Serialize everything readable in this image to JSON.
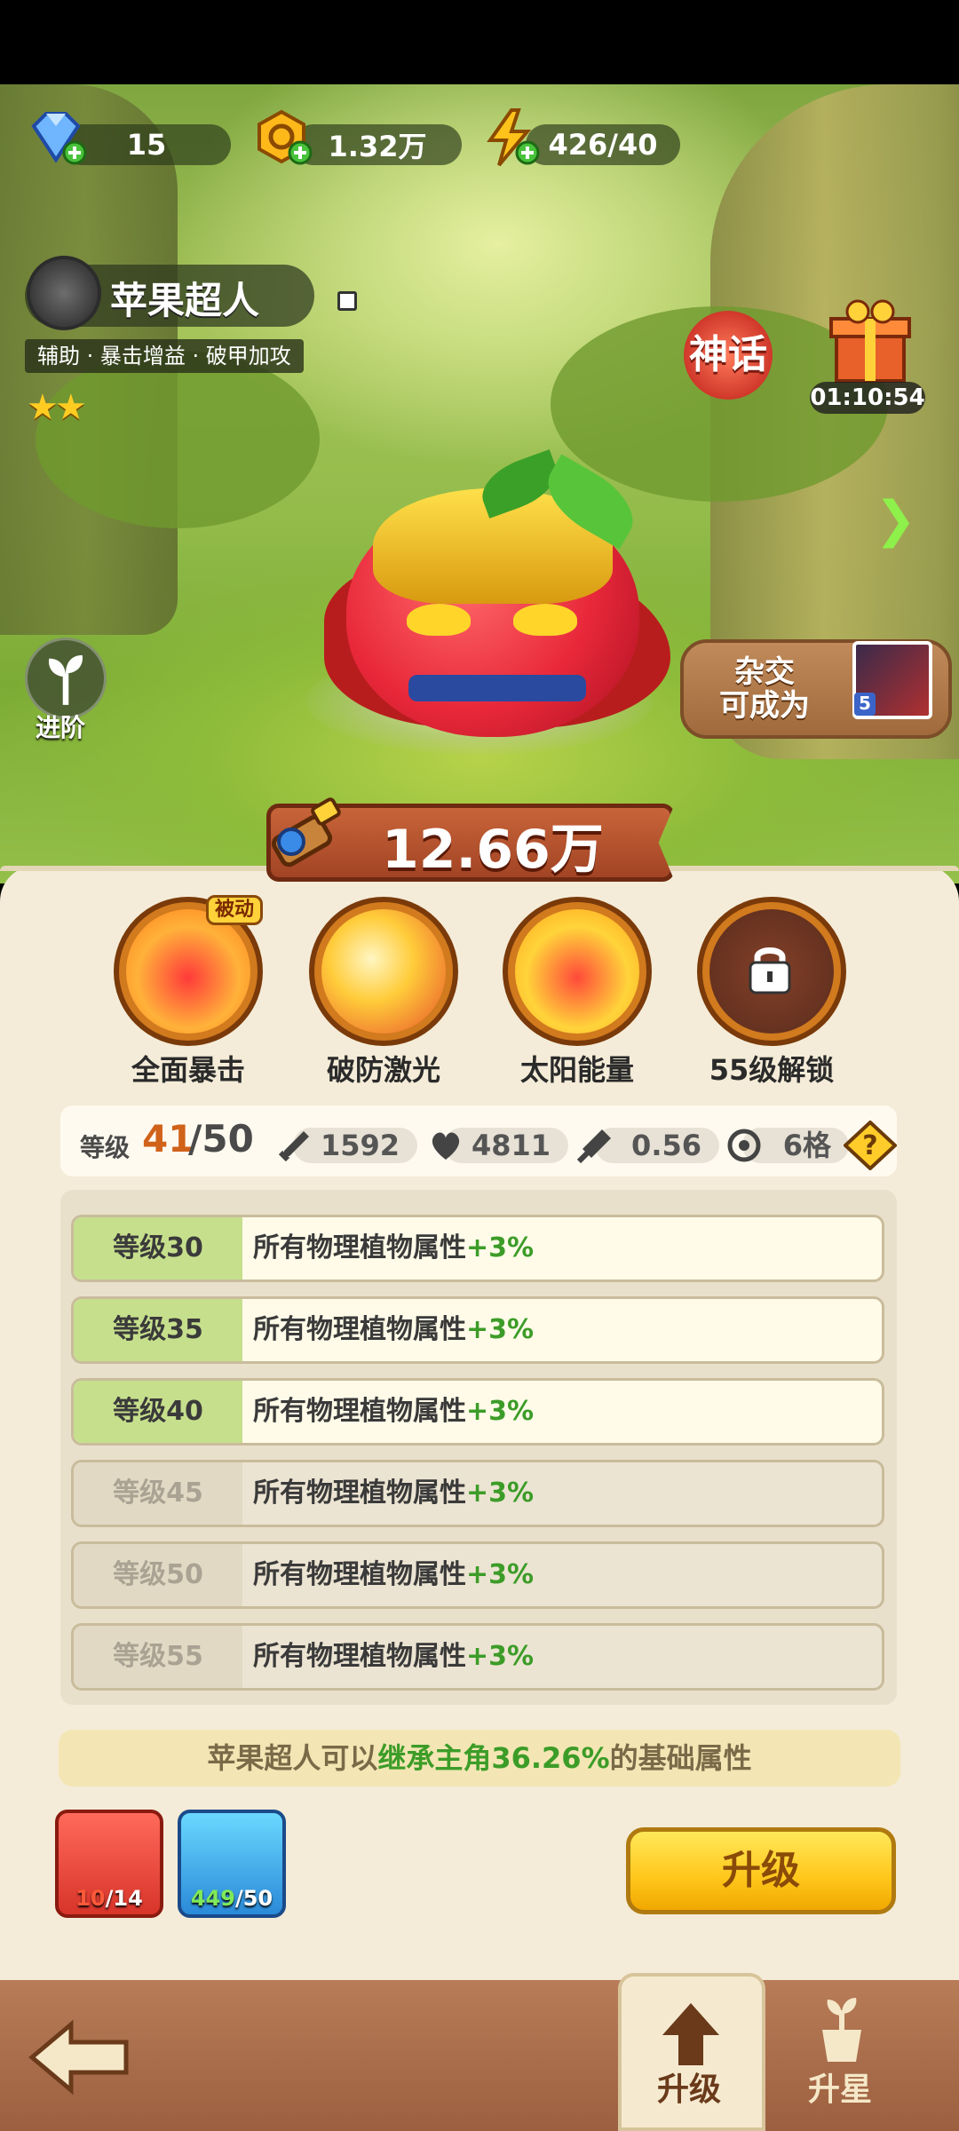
{
  "resources": {
    "gems": "15",
    "coins": "1.32万",
    "energy": "426/40"
  },
  "plant": {
    "name": "苹果超人",
    "tags": "辅助 · 暴击增益 · 破甲加攻",
    "stars": "★★",
    "rarity": "神话",
    "timer": "01:10:54",
    "advance_label": "进阶",
    "hybrid_line1": "杂交",
    "hybrid_line2": "可成为",
    "hybrid_level": "5",
    "power": "12.66万"
  },
  "skills": [
    {
      "label": "全面暴击",
      "badge": "被动"
    },
    {
      "label": "破防激光"
    },
    {
      "label": "太阳能量"
    },
    {
      "label": "55级解锁"
    }
  ],
  "stats": {
    "level_label": "等级",
    "level_current": "41",
    "level_max": "/50",
    "attack": "1592",
    "hp": "4811",
    "attack_speed": "0.56",
    "range": "6格"
  },
  "level_rewards": [
    {
      "level": "等级30",
      "desc": "所有物理植物属性",
      "bonus": "+3%",
      "unlocked": true
    },
    {
      "level": "等级35",
      "desc": "所有物理植物属性",
      "bonus": "+3%",
      "unlocked": true
    },
    {
      "level": "等级40",
      "desc": "所有物理植物属性",
      "bonus": "+3%",
      "unlocked": true
    },
    {
      "level": "等级45",
      "desc": "所有物理植物属性",
      "bonus": "+3%",
      "unlocked": false
    },
    {
      "level": "等级50",
      "desc": "所有物理植物属性",
      "bonus": "+3%",
      "unlocked": false
    },
    {
      "level": "等级55",
      "desc": "所有物理植物属性",
      "bonus": "+3%",
      "unlocked": false
    }
  ],
  "inherit": {
    "prefix": "苹果超人可以",
    "highlight": "继承主角36.26%",
    "suffix": "的基础属性"
  },
  "materials": [
    {
      "have": "10",
      "need": "/14"
    },
    {
      "have": "449",
      "need": "/50"
    }
  ],
  "upgrade_button": "升级",
  "nav": {
    "upgrade": "升级",
    "star_up": "升星"
  }
}
